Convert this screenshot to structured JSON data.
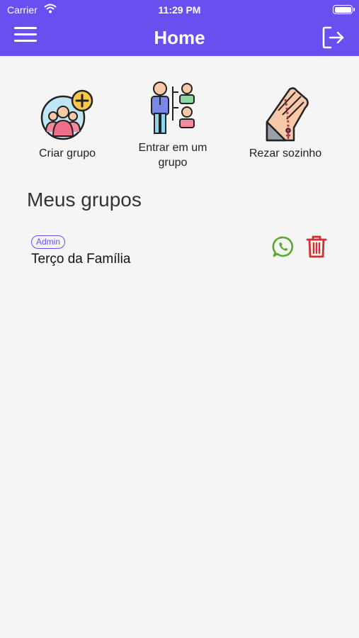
{
  "status_bar": {
    "carrier": "Carrier",
    "time": "11:29 PM"
  },
  "header": {
    "title": "Home",
    "menu_icon": "hamburger-menu-icon",
    "logout_icon": "logout-icon"
  },
  "actions": [
    {
      "label": "Criar grupo",
      "icon": "create-group-icon"
    },
    {
      "label": "Entrar em um grupo",
      "icon": "join-group-icon"
    },
    {
      "label": "Rezar sozinho",
      "icon": "praying-hands-rosary-icon"
    }
  ],
  "groups_section": {
    "title": "Meus grupos",
    "items": [
      {
        "badge": "Admin",
        "name": "Terço da Família",
        "share_icon": "whatsapp-icon",
        "delete_icon": "trash-icon"
      }
    ]
  },
  "colors": {
    "primary": "#6a4ff0",
    "whatsapp": "#5aaa2a",
    "delete": "#d32f2f",
    "background": "#f5f5f5"
  }
}
